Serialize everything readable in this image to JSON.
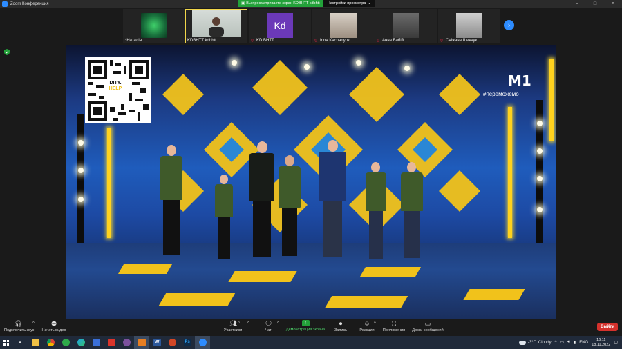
{
  "window": {
    "title": "Zoom Конференция",
    "controls": {
      "minimize": "–",
      "maximize": "□",
      "close": "✕"
    }
  },
  "banner": {
    "sharing": "Вы просматриваете экран KDBHTT kdbhtt",
    "view_options": "Настройки просмотра"
  },
  "thumbnails": [
    {
      "name": "*Наталія",
      "muted": false
    },
    {
      "name": "KDBHTT kdbhtt",
      "muted": false,
      "active": true
    },
    {
      "name": "KD ВНТТ",
      "muted": true,
      "initials": "Kd"
    },
    {
      "name": "Inna Kachanyuk",
      "muted": true
    },
    {
      "name": "Анна Бабій",
      "muted": true
    },
    {
      "name": "Сніжана Шевчук",
      "muted": true
    }
  ],
  "stage": {
    "qr_label_top": "DITY.",
    "qr_label_bottom": "HELP",
    "channel_logo": "M1",
    "hashtag": "#переможемо"
  },
  "toolbar": {
    "audio": "Подключить звук",
    "video": "Начать видео",
    "participants": "Участники",
    "participants_count": "8",
    "chat": "Чат",
    "share": "Демонстрация экрана",
    "record": "Запись",
    "reactions": "Реакции",
    "apps": "Приложения",
    "whiteboards": "Доски сообщений",
    "leave": "Выйти"
  },
  "taskbar": {
    "weather_temp": "-3°C",
    "weather_text": "Cloudy",
    "language": "ENG",
    "time": "16:11",
    "date": "18.11.2022"
  },
  "colors": {
    "zoom_blue": "#2d8cff",
    "share_green": "#23a23a",
    "leave_red": "#d5312c",
    "stage_yellow": "#f1c21b"
  }
}
